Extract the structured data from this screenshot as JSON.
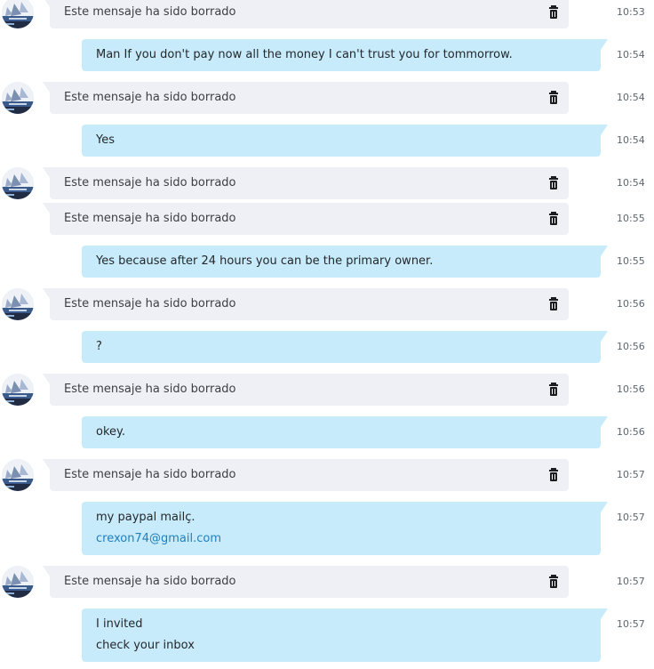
{
  "messages": [
    {
      "dir": "in",
      "avatar": true,
      "lines": [
        "Este mensaje ha sido borrado"
      ],
      "deleted": true,
      "time": "10:53"
    },
    {
      "dir": "out",
      "lines": [
        "Man If you don't pay now all the money I can't trust you for tommorrow."
      ],
      "time": "10:54"
    },
    {
      "dir": "in",
      "avatar": true,
      "lines": [
        "Este mensaje ha sido borrado"
      ],
      "deleted": true,
      "time": "10:54"
    },
    {
      "dir": "out",
      "lines": [
        "Yes"
      ],
      "time": "10:54"
    },
    {
      "dir": "in",
      "avatar": true,
      "lines": [
        "Este mensaje ha sido borrado"
      ],
      "deleted": true,
      "time": "10:54"
    },
    {
      "dir": "in",
      "avatar": false,
      "lines": [
        "Este mensaje ha sido borrado"
      ],
      "deleted": true,
      "time": "10:55"
    },
    {
      "dir": "out",
      "lines": [
        "Yes because after 24 hours you can be the primary owner."
      ],
      "time": "10:55"
    },
    {
      "dir": "in",
      "avatar": true,
      "lines": [
        "Este mensaje ha sido borrado"
      ],
      "deleted": true,
      "time": "10:56"
    },
    {
      "dir": "out",
      "lines": [
        "?"
      ],
      "time": "10:56"
    },
    {
      "dir": "in",
      "avatar": true,
      "lines": [
        "Este mensaje ha sido borrado"
      ],
      "deleted": true,
      "time": "10:56"
    },
    {
      "dir": "out",
      "lines": [
        "okey."
      ],
      "time": "10:56"
    },
    {
      "dir": "in",
      "avatar": true,
      "lines": [
        "Este mensaje ha sido borrado"
      ],
      "deleted": true,
      "time": "10:57"
    },
    {
      "dir": "out",
      "lines": [
        "my paypal mailç.",
        "crexon74@gmail.com"
      ],
      "link_line": 1,
      "time": "10:57"
    },
    {
      "dir": "in",
      "avatar": true,
      "lines": [
        "Este mensaje ha sido borrado"
      ],
      "deleted": true,
      "time": "10:57"
    },
    {
      "dir": "out",
      "lines": [
        "I invited",
        "check your inbox"
      ],
      "time": "10:57"
    }
  ],
  "icons": {
    "deleted": "trash-icon",
    "avatar": "contact-avatar"
  },
  "colors": {
    "incoming_bubble": "#eef0f5",
    "outgoing_bubble": "#c7ebfb",
    "link": "#1f7fbf",
    "timestamp": "#5c6670"
  }
}
